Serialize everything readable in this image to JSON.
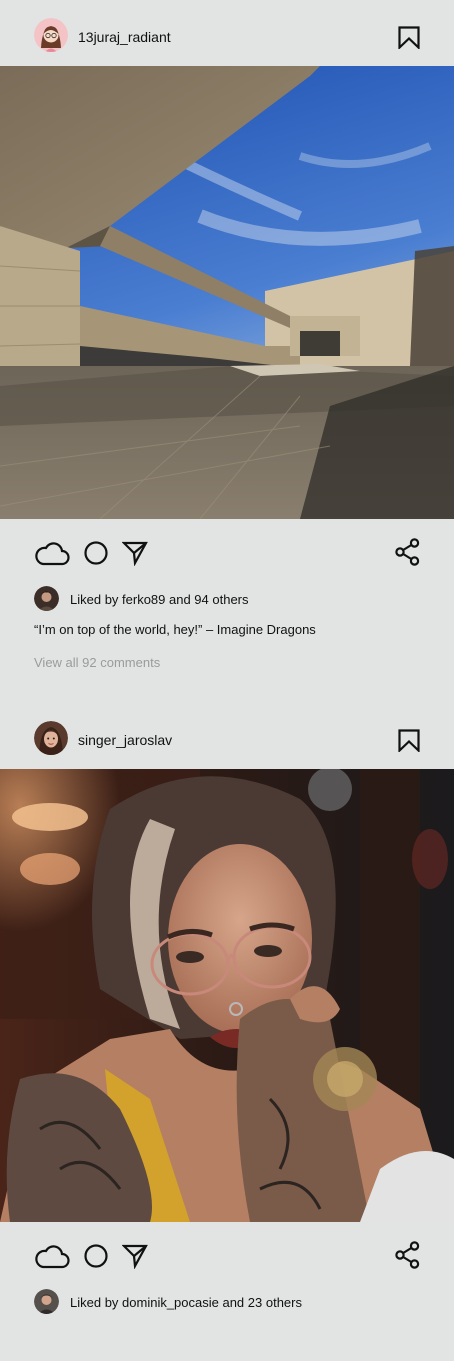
{
  "posts": [
    {
      "username": "13juraj_radiant",
      "liked_text": "Liked by ferko89 and 94 others",
      "caption": "“I’m on top of the world, hey!” – Imagine Dragons",
      "comments_link": "View all 92 comments"
    },
    {
      "username": "singer_jaroslav",
      "liked_text": "Liked by dominik_pocasie and 23 others"
    }
  ],
  "icons": {
    "like": "cloud-icon",
    "comment": "circle-icon",
    "send": "send-icon",
    "share": "share-icon",
    "save": "bookmark-icon"
  },
  "colors": {
    "background": "#e2e4e4",
    "text": "#111111",
    "muted": "#9a9c9c"
  }
}
